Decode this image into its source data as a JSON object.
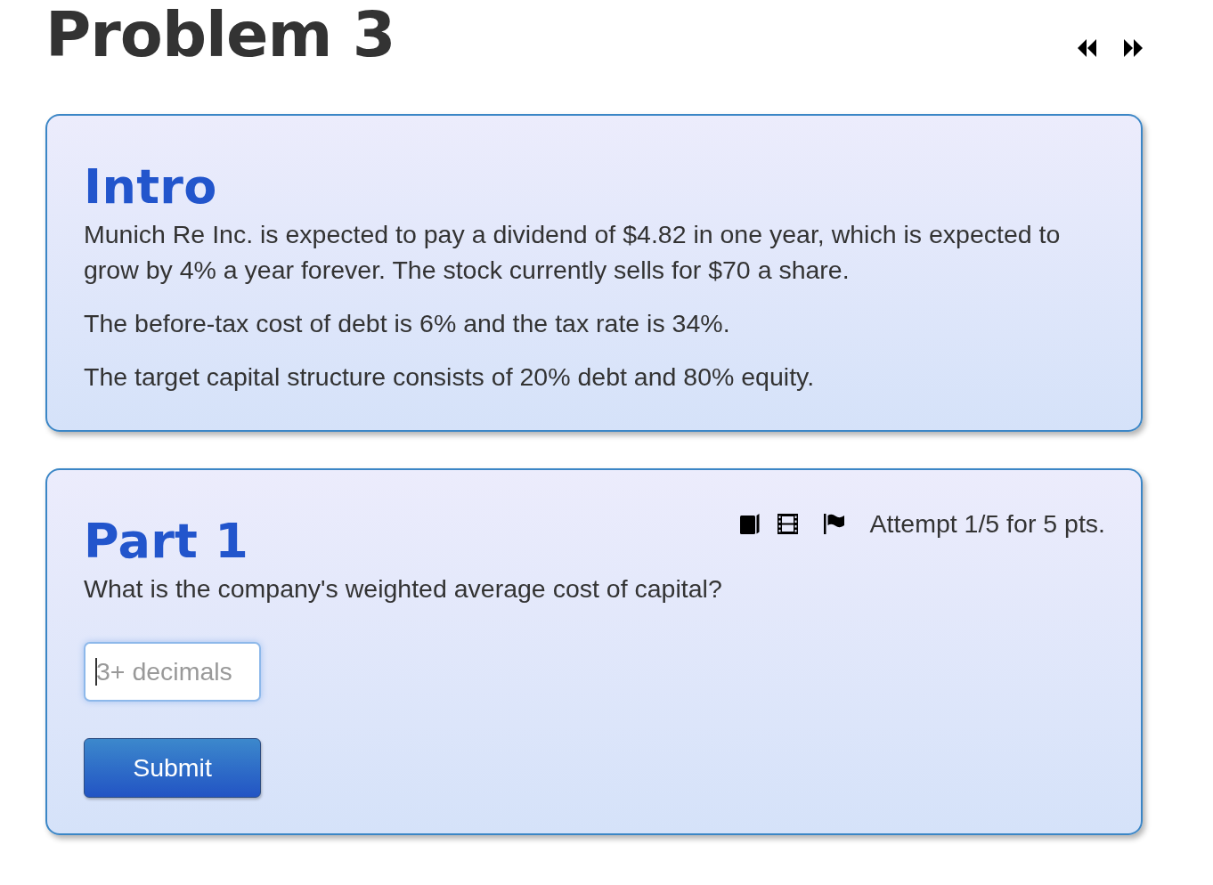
{
  "header": {
    "title": "Problem 3",
    "nav": [
      {
        "kind": "previous"
      },
      {
        "kind": "next"
      }
    ]
  },
  "intro": {
    "heading": "Intro",
    "paragraphs": [
      "Munich Re Inc. is expected to pay a dividend of $4.82 in one year, which is expected to grow by 4% a year forever. The stock currently sells for $70 a share.",
      "The before-tax cost of debt is 6% and the tax rate is 34%.",
      "The target capital structure consists of 20% debt and 80% equity."
    ]
  },
  "part": {
    "heading": "Part 1",
    "tools": [
      {
        "kind": "book"
      },
      {
        "kind": "film"
      },
      {
        "kind": "flag"
      }
    ],
    "attempt": "Attempt 1/5 for 5 pts.",
    "question": "What is the company's weighted average cost of capital?",
    "answer": {
      "placeholder": "3+ decimals",
      "focused": true
    },
    "submit": "Submit"
  }
}
